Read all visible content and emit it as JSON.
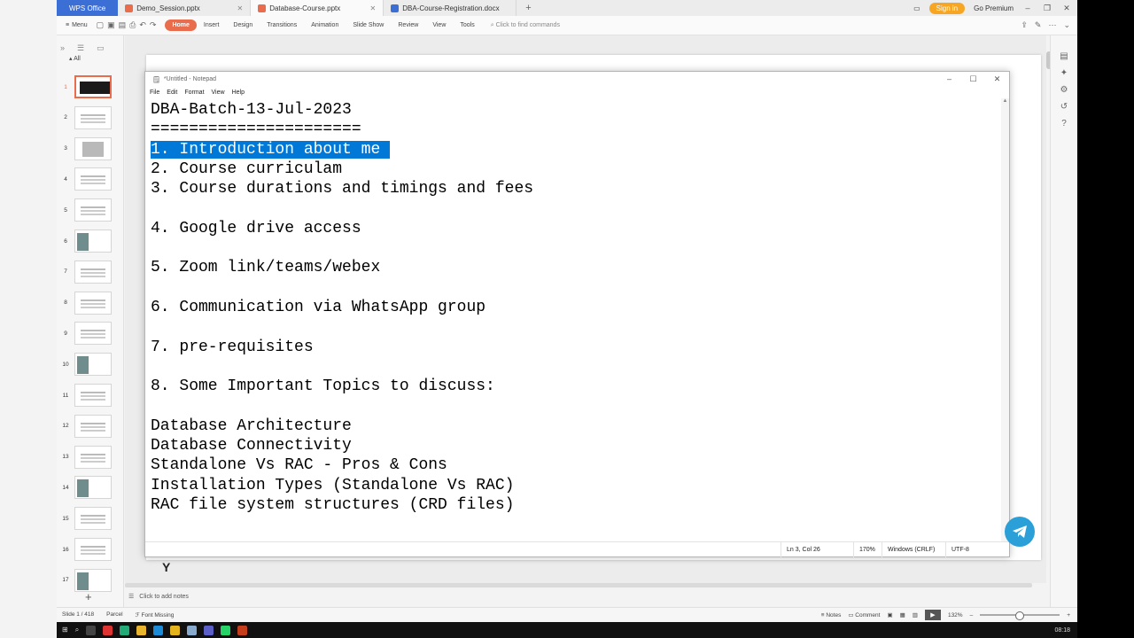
{
  "titlebar": {
    "app_tab": "WPS Office",
    "tabs": [
      {
        "label": "Demo_Session.pptx",
        "color": "#e96c4c"
      },
      {
        "label": "Database-Course.pptx",
        "color": "#e96c4c"
      },
      {
        "label": "DBA-Course-Registration.docx",
        "color": "#3c6fd6"
      }
    ],
    "signin": "Sign in",
    "premium": "Go Premium"
  },
  "ribbon": {
    "menu": "Menu",
    "tabs": [
      "Home",
      "Insert",
      "Design",
      "Transitions",
      "Animation",
      "Slide Show",
      "Review",
      "View",
      "Tools"
    ],
    "find_placeholder": "Click to find commands"
  },
  "slide_panel": {
    "all_label": "All",
    "slide_numbers": [
      "1",
      "2",
      "3",
      "4",
      "5",
      "6",
      "7",
      "8",
      "9",
      "10",
      "11",
      "12",
      "13",
      "14",
      "15",
      "16",
      "17"
    ]
  },
  "slide": {
    "partial_text": "Y"
  },
  "notepad": {
    "title": "*Untitled - Notepad",
    "menu": [
      "File",
      "Edit",
      "Format",
      "View",
      "Help"
    ],
    "lines": [
      "DBA-Batch-13-Jul-2023",
      "======================",
      "1. Introduction about me",
      "2. Course curriculam",
      "3. Course durations and timings and fees",
      "",
      "4. Google drive access",
      "",
      "5. Zoom link/teams/webex",
      "",
      "6. Communication via WhatsApp group",
      "",
      "7. pre-requisites",
      "",
      "8. Some Important Topics to discuss:",
      "",
      "Database Architecture",
      "Database Connectivity",
      "Standalone Vs RAC - Pros & Cons",
      "Installation Types (Standalone Vs RAC)",
      "RAC file system structures (CRD files)"
    ],
    "selected_line": 2,
    "status": {
      "position": "Ln 3, Col 26",
      "zoom": "170%",
      "line_ending": "Windows (CRLF)",
      "encoding": "UTF-8"
    }
  },
  "notes": {
    "placeholder": "Click to add notes"
  },
  "statusbar": {
    "slide_count": "Slide 1 / 418",
    "theme": "Parcel",
    "font_missing": "Font Missing",
    "notes": "Notes",
    "comment": "Comment",
    "zoom": "132%"
  },
  "taskbar": {
    "clock": "08:18"
  },
  "colors": {
    "accent": "#e96c4c",
    "selection": "#0078d7",
    "wps_blue": "#3c6fd6"
  }
}
